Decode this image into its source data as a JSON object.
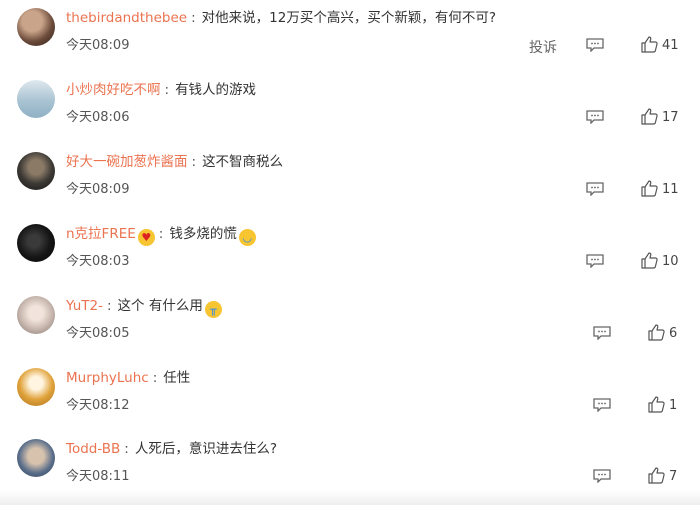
{
  "comments": [
    {
      "username": "thebirdandthebee",
      "text": "对他来说，12万买个高兴，买个新颖，有何不可?",
      "time": "今天08:09",
      "report": "投诉",
      "likes": "41",
      "avatar_color": "#6b4a3a"
    },
    {
      "username": "小炒肉好吃不啊",
      "text": "有钱人的游戏",
      "time": "今天08:06",
      "likes": "17",
      "avatar_color": "#a9c3d3"
    },
    {
      "username": "好大一碗加葱炸酱面",
      "text": "这不智商税么",
      "time": "今天08:09",
      "likes": "11",
      "avatar_color": "#3d3a36"
    },
    {
      "username": "n克拉FREE",
      "emoji_after_name": "heart-eyes-emoji",
      "text": "钱多烧的慌",
      "emoji_after_text": "laughing-tears-emoji",
      "time": "今天08:03",
      "likes": "10",
      "avatar_color": "#151515"
    },
    {
      "username": "YuT2-",
      "text": "这个 有什么用",
      "emoji_after_text": "crying-emoji",
      "time": "今天08:05",
      "likes": "6",
      "avatar_color": "#c9b9b0"
    },
    {
      "username": "MurphyLuhc",
      "text": "任性",
      "time": "今天08:12",
      "likes": "1",
      "avatar_color": "#e0a23a"
    },
    {
      "username": "Todd-BB",
      "text": "人死后，意识进去住么?",
      "time": "今天08:11",
      "likes": "7",
      "avatar_color": "#5a6e8a"
    }
  ],
  "colors": {
    "username": "#eb7350",
    "text": "#333333",
    "meta": "#555555"
  }
}
